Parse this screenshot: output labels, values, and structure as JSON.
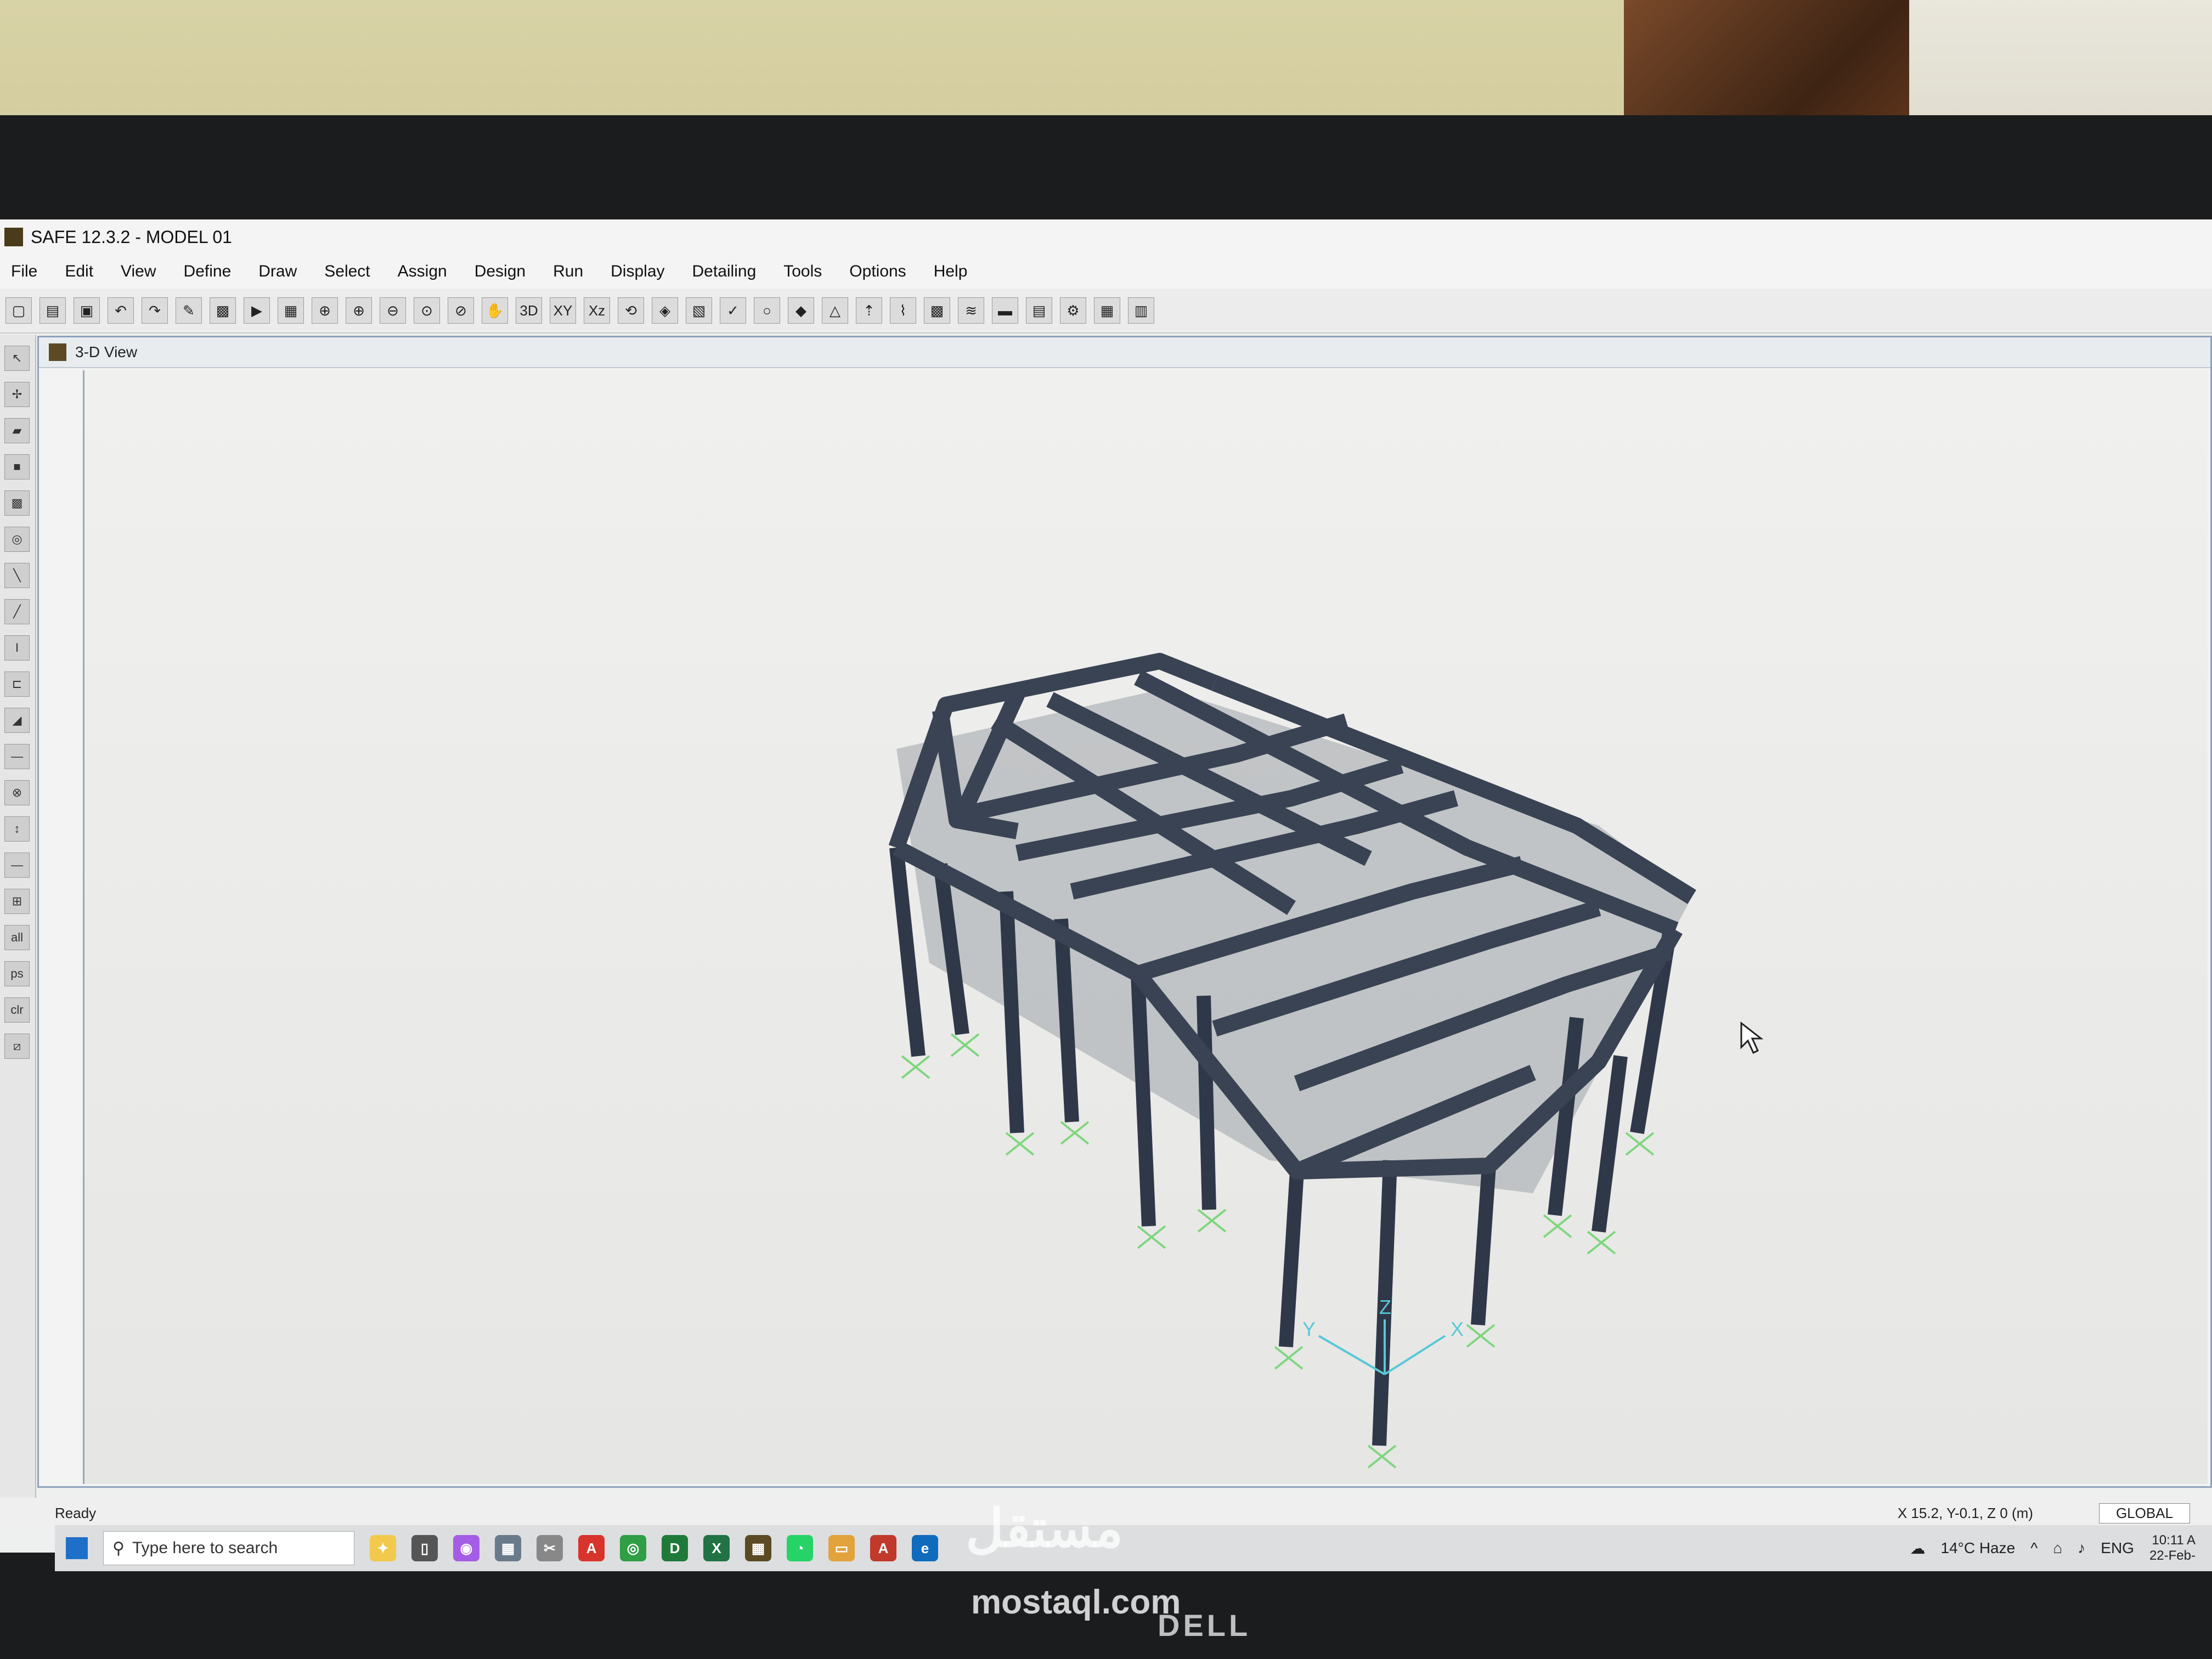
{
  "window": {
    "title": "SAFE 12.3.2 - MODEL 01"
  },
  "menu": [
    "File",
    "Edit",
    "View",
    "Define",
    "Draw",
    "Select",
    "Assign",
    "Design",
    "Run",
    "Display",
    "Detailing",
    "Tools",
    "Options",
    "Help"
  ],
  "toolbar": {
    "view_3d": "3D",
    "view_xy": "XY",
    "view_xz": "Xz"
  },
  "left_tools": {
    "all": "all",
    "ps": "ps",
    "clr": "clr"
  },
  "view": {
    "title": "3-D View"
  },
  "axes": {
    "x": "X",
    "y": "Y",
    "z": "Z"
  },
  "status": {
    "text": "Ready",
    "coords": "X 15.2, Y-0.1, Z 0 (m)",
    "system": "GLOBAL"
  },
  "taskbar": {
    "search_placeholder": "Type here to search",
    "weather": "14°C  Haze",
    "lang": "ENG",
    "time": "10:11 A",
    "date": "22-Feb-"
  },
  "monitor_brand": "DELL",
  "watermark": {
    "arabic": "مستقل",
    "url": "mostaql.com"
  },
  "colors": {
    "frame": "#3a4354",
    "slab": "#8f959c",
    "support": "#7fd67f",
    "background": "#eef0ef"
  }
}
